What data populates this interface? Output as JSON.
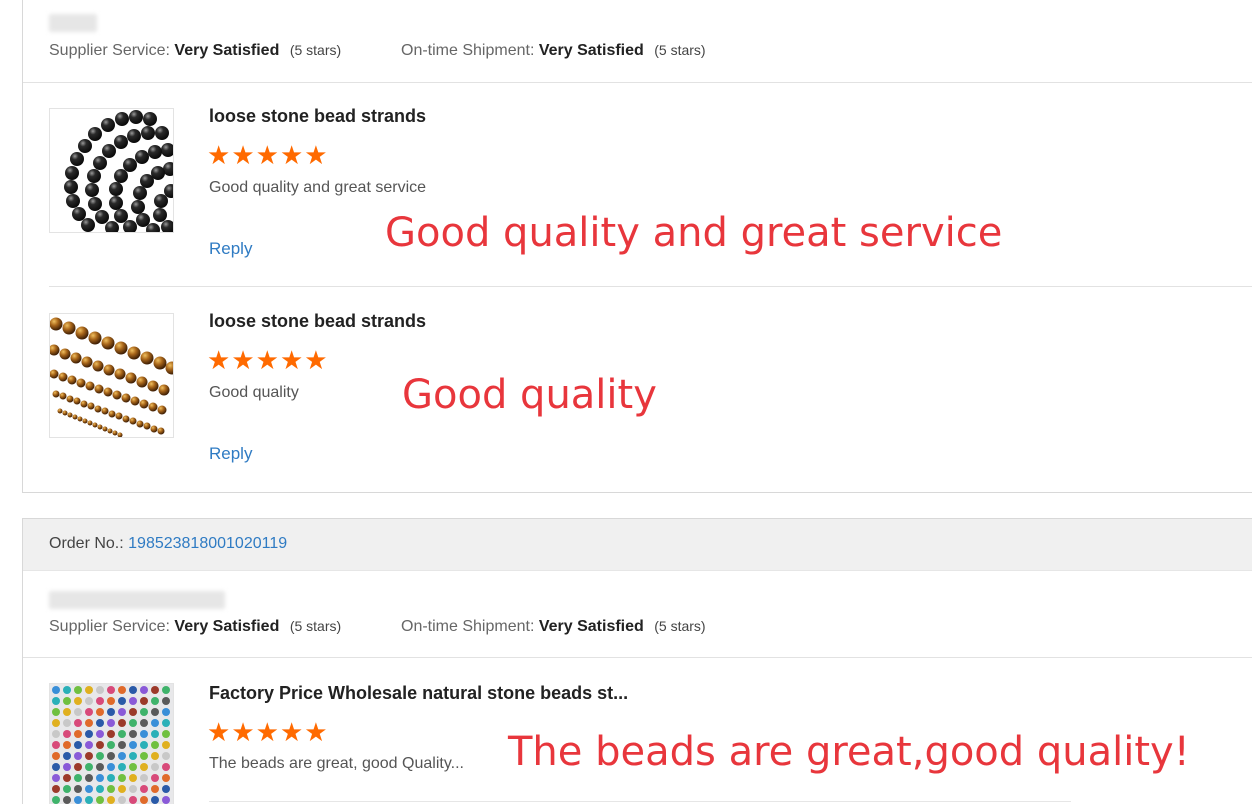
{
  "colors": {
    "accent_orange": "#ff6a00",
    "link_blue": "#2f7bc3",
    "annotation_red": "#e8363c"
  },
  "labels": {
    "supplier_service": "Supplier Service:",
    "ontime_shipment": "On-time Shipment:",
    "order_no": "Order No.:",
    "reply": "Reply"
  },
  "feedback_1": {
    "supplier_service": {
      "value": "Very Satisfied",
      "stars_text": "(5 stars)"
    },
    "ontime_shipment": {
      "value": "Very Satisfied",
      "stars_text": "(5 stars)"
    },
    "items": [
      {
        "title": "loose stone bead strands",
        "rating": 5,
        "comment": "Good quality and great service",
        "annotation": "Good quality and great service",
        "image": "black-beads"
      },
      {
        "title": "loose stone bead strands",
        "rating": 5,
        "comment": "Good quality",
        "annotation": "Good quality",
        "image": "tiger-eye-beads"
      }
    ]
  },
  "feedback_2": {
    "order_number": "198523818001020119",
    "supplier_service": {
      "value": "Very Satisfied",
      "stars_text": "(5 stars)"
    },
    "ontime_shipment": {
      "value": "Very Satisfied",
      "stars_text": "(5 stars)"
    },
    "items": [
      {
        "title": "Factory Price Wholesale natural stone beads st...",
        "rating": 5,
        "comment": "The beads are great, good Quality...",
        "annotation": "The beads are great,good quality!",
        "image": "bead-sample-board"
      }
    ]
  }
}
